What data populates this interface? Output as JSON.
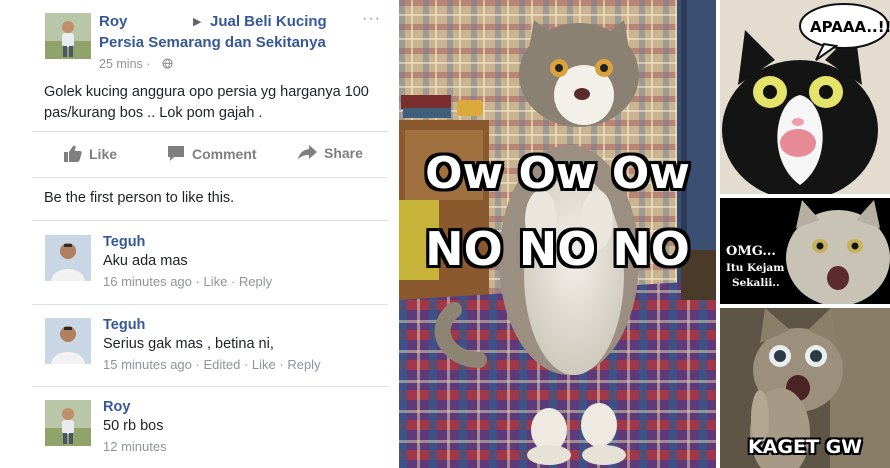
{
  "post": {
    "author": "Roy",
    "group_line1": "Jual Beli Kucing",
    "group_line2": "Persia Semarang dan Sekitanya",
    "time": "25 mins ·",
    "text": "Golek kucing anggura opo persia yg harganya 100 pas/kurang bos .. Lok pom gajah .",
    "more": "···"
  },
  "actions": {
    "like": "Like",
    "comment": "Comment",
    "share": "Share"
  },
  "likes_text": "Be the first person to like this.",
  "comments": [
    {
      "name": "Teguh",
      "text": "Aku ada mas",
      "time": "16 minutes ago",
      "sep1": " · ",
      "like": "Like",
      "sep2": " · ",
      "reply": "Reply"
    },
    {
      "name": "Teguh",
      "text": "Serius gak mas , betina ni,",
      "time": "15 minutes ago",
      "sep1": " · ",
      "edited": "Edited",
      "sep2": " · ",
      "like": "Like",
      "sep3": " · ",
      "reply": "Reply"
    },
    {
      "name": "Roy",
      "text": "50 rb bos",
      "time": "12 minutes"
    }
  ],
  "meme": {
    "line1": "Ow Ow Ow",
    "line2": "NO NO NO"
  },
  "panels": {
    "bubble": "APAAA..!!",
    "omg_line1": "OMG...",
    "omg_line2": "Itu Kejam",
    "omg_line3": "Sekalii..",
    "kaget": "KAGET GW"
  },
  "colors": {
    "link": "#365899",
    "meta": "#90949c",
    "divider": "#dddfe2"
  }
}
